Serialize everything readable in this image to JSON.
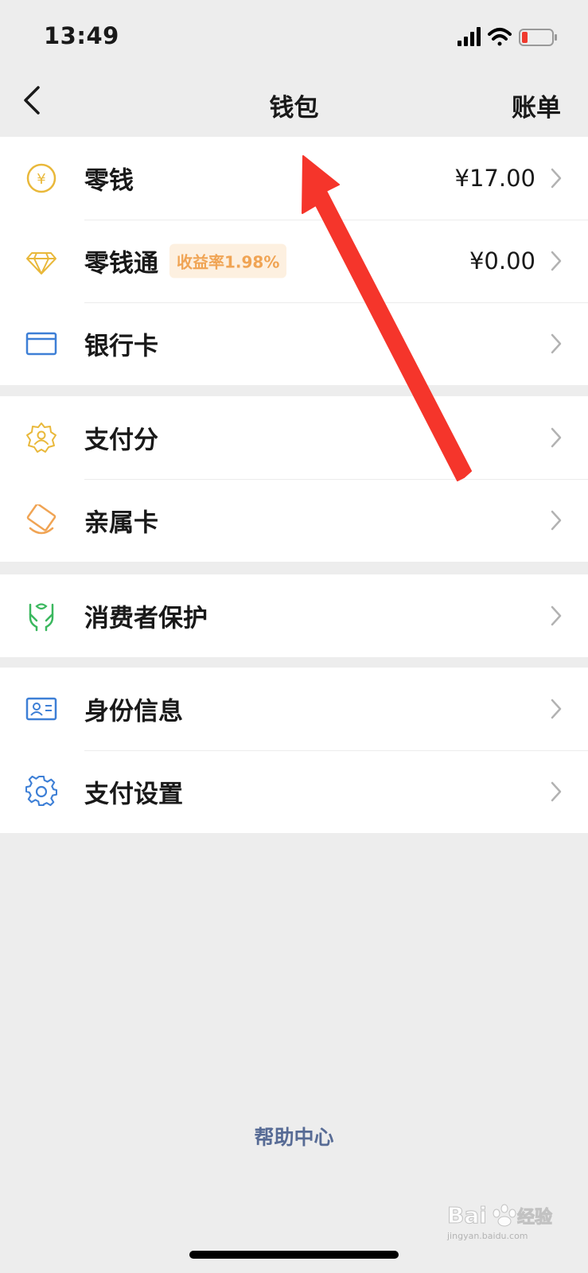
{
  "status_bar": {
    "time": "13:49"
  },
  "nav": {
    "title": "钱包",
    "action": "账单"
  },
  "groups": [
    {
      "rows": [
        {
          "label": "零钱",
          "value": "¥17.00",
          "icon": "yuan-coin-icon"
        },
        {
          "label": "零钱通",
          "badge": "收益率1.98%",
          "value": "¥0.00",
          "icon": "diamond-icon"
        },
        {
          "label": "银行卡",
          "icon": "bank-card-icon"
        }
      ]
    },
    {
      "rows": [
        {
          "label": "支付分",
          "icon": "credit-score-icon"
        },
        {
          "label": "亲属卡",
          "icon": "family-card-icon"
        }
      ]
    },
    {
      "rows": [
        {
          "label": "消费者保护",
          "icon": "protected-hands-icon"
        }
      ]
    },
    {
      "rows": [
        {
          "label": "身份信息",
          "icon": "id-card-icon"
        },
        {
          "label": "支付设置",
          "icon": "gear-icon"
        }
      ]
    }
  ],
  "footer": {
    "help_link": "帮助中心"
  },
  "watermark": {
    "brand": "Bai du 经验",
    "url": "jingyan.baidu.com"
  },
  "colors": {
    "background": "#ededed",
    "link": "#576b95",
    "badge_text": "#f0a454",
    "badge_bg": "#fdf0e0",
    "annotation_arrow": "#f5352b"
  }
}
